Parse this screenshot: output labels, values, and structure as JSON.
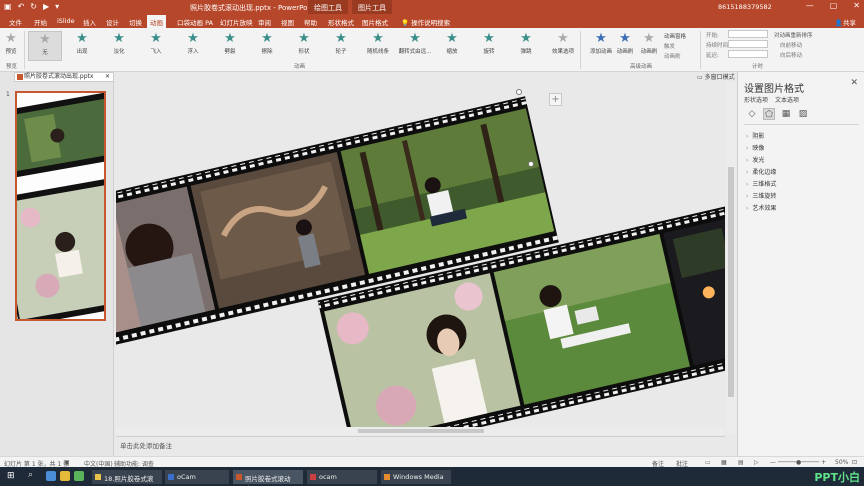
{
  "titlebar": {
    "doc_title": "照片胶卷式滚动出现.pptx - PowerPoint",
    "context_tab1": "绘图工具",
    "context_tab2": "图片工具",
    "account": "8615188379582",
    "win_min": "—",
    "win_max": "▢",
    "win_close": "✕"
  },
  "tabs": [
    "文件",
    "开始",
    "iSlide",
    "插入",
    "设计",
    "切换",
    "动画",
    "口袋动画 PA",
    "幻灯片放映",
    "审阅",
    "视图",
    "帮助",
    "形状格式",
    "图片格式",
    "操作说明搜索"
  ],
  "share": "共享",
  "ribbon": {
    "preview": "预览",
    "effects": [
      {
        "label": "无",
        "style": "gray sel"
      },
      {
        "label": "出现",
        "style": ""
      },
      {
        "label": "淡化",
        "style": ""
      },
      {
        "label": "飞入",
        "style": ""
      },
      {
        "label": "浮入",
        "style": ""
      },
      {
        "label": "劈裂",
        "style": ""
      },
      {
        "label": "擦除",
        "style": ""
      },
      {
        "label": "形状",
        "style": ""
      },
      {
        "label": "轮子",
        "style": ""
      },
      {
        "label": "随机线条",
        "style": ""
      },
      {
        "label": "翻转式由远...",
        "style": ""
      },
      {
        "label": "缩放",
        "style": ""
      },
      {
        "label": "旋转",
        "style": ""
      },
      {
        "label": "弹跳",
        "style": ""
      },
      {
        "label": "效果选项",
        "style": "gray"
      }
    ],
    "add_animation": "添加动画",
    "anim_painter": "动画刷",
    "anim_pane": "动画窗格",
    "trigger": "触发",
    "anim_brush": "动画刷",
    "start": "开始:",
    "duration": "持续时间:",
    "delay": "延迟:",
    "reorder": "对动画重新排序",
    "move_earlier": "向前移动",
    "move_later": "向后移动",
    "group_preview": "预览",
    "group_animation": "动画",
    "group_advanced": "高级动画",
    "group_timing": "计时"
  },
  "doctab": {
    "name": "照片胶卷式滚动出现.pptx",
    "close": "✕"
  },
  "multi_window": "多窗口模式",
  "slide_number": "1",
  "plus": "+",
  "notes_placeholder": "单击此处添加备注",
  "pane": {
    "title": "设置图片格式",
    "close": "✕",
    "sub1": "形状选项",
    "sub2": "文本选项",
    "sections": [
      "阴影",
      "映像",
      "发光",
      "柔化边缘",
      "三维格式",
      "三维旋转",
      "艺术效果"
    ]
  },
  "status": {
    "slide": "幻灯片 第 1 张，共 1 张",
    "lang": "中文(中国)",
    "access": "辅助功能: 调查",
    "notes": "备注",
    "comments": "批注",
    "zoom": "50%"
  },
  "ime": [
    "中",
    "半",
    "。",
    "⚙"
  ],
  "taskbar": {
    "items": [
      "18.照片胶卷式滚动...",
      "oCam",
      "照片胶卷式滚动出...",
      "ocam",
      "Windows Media ..."
    ],
    "watermark": "PPT小白"
  }
}
